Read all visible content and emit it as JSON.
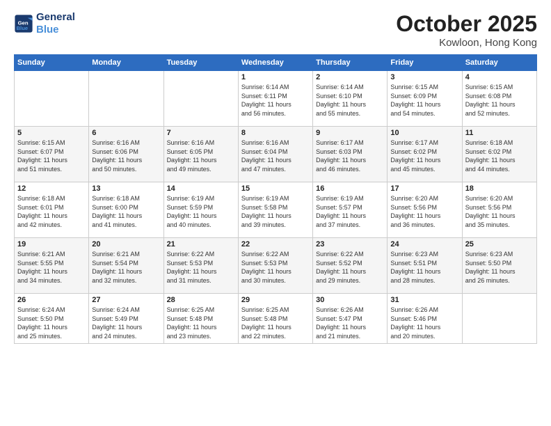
{
  "header": {
    "logo_line1": "General",
    "logo_line2": "Blue",
    "month": "October 2025",
    "location": "Kowloon, Hong Kong"
  },
  "weekdays": [
    "Sunday",
    "Monday",
    "Tuesday",
    "Wednesday",
    "Thursday",
    "Friday",
    "Saturday"
  ],
  "weeks": [
    [
      {
        "day": "",
        "info": ""
      },
      {
        "day": "",
        "info": ""
      },
      {
        "day": "",
        "info": ""
      },
      {
        "day": "1",
        "info": "Sunrise: 6:14 AM\nSunset: 6:11 PM\nDaylight: 11 hours\nand 56 minutes."
      },
      {
        "day": "2",
        "info": "Sunrise: 6:14 AM\nSunset: 6:10 PM\nDaylight: 11 hours\nand 55 minutes."
      },
      {
        "day": "3",
        "info": "Sunrise: 6:15 AM\nSunset: 6:09 PM\nDaylight: 11 hours\nand 54 minutes."
      },
      {
        "day": "4",
        "info": "Sunrise: 6:15 AM\nSunset: 6:08 PM\nDaylight: 11 hours\nand 52 minutes."
      }
    ],
    [
      {
        "day": "5",
        "info": "Sunrise: 6:15 AM\nSunset: 6:07 PM\nDaylight: 11 hours\nand 51 minutes."
      },
      {
        "day": "6",
        "info": "Sunrise: 6:16 AM\nSunset: 6:06 PM\nDaylight: 11 hours\nand 50 minutes."
      },
      {
        "day": "7",
        "info": "Sunrise: 6:16 AM\nSunset: 6:05 PM\nDaylight: 11 hours\nand 49 minutes."
      },
      {
        "day": "8",
        "info": "Sunrise: 6:16 AM\nSunset: 6:04 PM\nDaylight: 11 hours\nand 47 minutes."
      },
      {
        "day": "9",
        "info": "Sunrise: 6:17 AM\nSunset: 6:03 PM\nDaylight: 11 hours\nand 46 minutes."
      },
      {
        "day": "10",
        "info": "Sunrise: 6:17 AM\nSunset: 6:02 PM\nDaylight: 11 hours\nand 45 minutes."
      },
      {
        "day": "11",
        "info": "Sunrise: 6:18 AM\nSunset: 6:02 PM\nDaylight: 11 hours\nand 44 minutes."
      }
    ],
    [
      {
        "day": "12",
        "info": "Sunrise: 6:18 AM\nSunset: 6:01 PM\nDaylight: 11 hours\nand 42 minutes."
      },
      {
        "day": "13",
        "info": "Sunrise: 6:18 AM\nSunset: 6:00 PM\nDaylight: 11 hours\nand 41 minutes."
      },
      {
        "day": "14",
        "info": "Sunrise: 6:19 AM\nSunset: 5:59 PM\nDaylight: 11 hours\nand 40 minutes."
      },
      {
        "day": "15",
        "info": "Sunrise: 6:19 AM\nSunset: 5:58 PM\nDaylight: 11 hours\nand 39 minutes."
      },
      {
        "day": "16",
        "info": "Sunrise: 6:19 AM\nSunset: 5:57 PM\nDaylight: 11 hours\nand 37 minutes."
      },
      {
        "day": "17",
        "info": "Sunrise: 6:20 AM\nSunset: 5:56 PM\nDaylight: 11 hours\nand 36 minutes."
      },
      {
        "day": "18",
        "info": "Sunrise: 6:20 AM\nSunset: 5:56 PM\nDaylight: 11 hours\nand 35 minutes."
      }
    ],
    [
      {
        "day": "19",
        "info": "Sunrise: 6:21 AM\nSunset: 5:55 PM\nDaylight: 11 hours\nand 34 minutes."
      },
      {
        "day": "20",
        "info": "Sunrise: 6:21 AM\nSunset: 5:54 PM\nDaylight: 11 hours\nand 32 minutes."
      },
      {
        "day": "21",
        "info": "Sunrise: 6:22 AM\nSunset: 5:53 PM\nDaylight: 11 hours\nand 31 minutes."
      },
      {
        "day": "22",
        "info": "Sunrise: 6:22 AM\nSunset: 5:53 PM\nDaylight: 11 hours\nand 30 minutes."
      },
      {
        "day": "23",
        "info": "Sunrise: 6:22 AM\nSunset: 5:52 PM\nDaylight: 11 hours\nand 29 minutes."
      },
      {
        "day": "24",
        "info": "Sunrise: 6:23 AM\nSunset: 5:51 PM\nDaylight: 11 hours\nand 28 minutes."
      },
      {
        "day": "25",
        "info": "Sunrise: 6:23 AM\nSunset: 5:50 PM\nDaylight: 11 hours\nand 26 minutes."
      }
    ],
    [
      {
        "day": "26",
        "info": "Sunrise: 6:24 AM\nSunset: 5:50 PM\nDaylight: 11 hours\nand 25 minutes."
      },
      {
        "day": "27",
        "info": "Sunrise: 6:24 AM\nSunset: 5:49 PM\nDaylight: 11 hours\nand 24 minutes."
      },
      {
        "day": "28",
        "info": "Sunrise: 6:25 AM\nSunset: 5:48 PM\nDaylight: 11 hours\nand 23 minutes."
      },
      {
        "day": "29",
        "info": "Sunrise: 6:25 AM\nSunset: 5:48 PM\nDaylight: 11 hours\nand 22 minutes."
      },
      {
        "day": "30",
        "info": "Sunrise: 6:26 AM\nSunset: 5:47 PM\nDaylight: 11 hours\nand 21 minutes."
      },
      {
        "day": "31",
        "info": "Sunrise: 6:26 AM\nSunset: 5:46 PM\nDaylight: 11 hours\nand 20 minutes."
      },
      {
        "day": "",
        "info": ""
      }
    ]
  ]
}
